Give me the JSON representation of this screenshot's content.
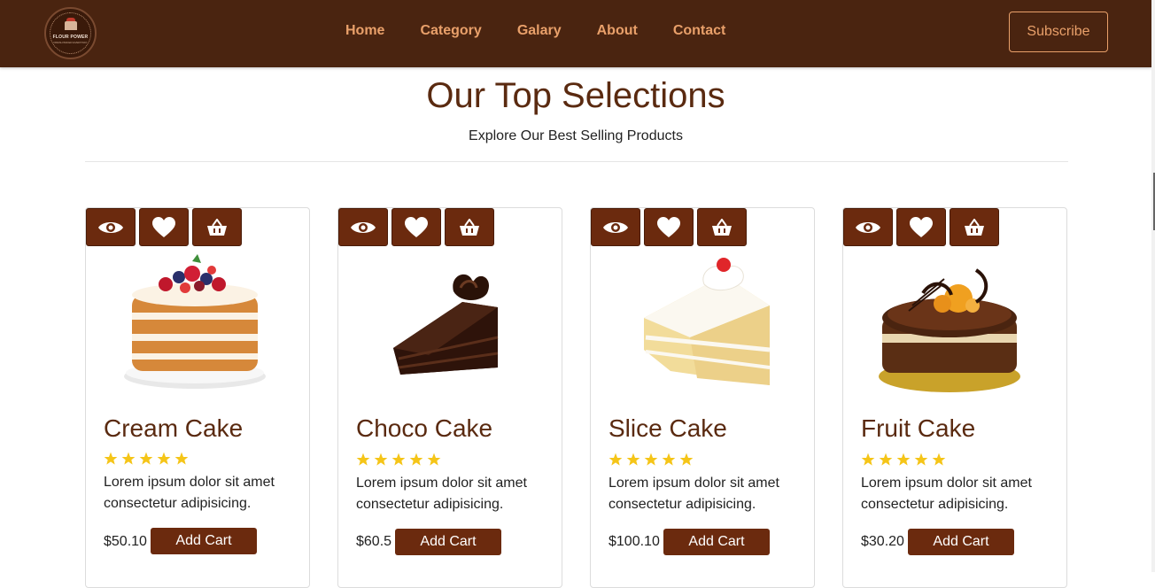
{
  "nav": {
    "logo_text": "FLOUR POWER",
    "logo_sub": "FRESH BAKED EVERYDAY",
    "links": [
      "Home",
      "Category",
      "Galary",
      "About",
      "Contact"
    ],
    "subscribe_label": "Subscribe"
  },
  "section": {
    "title": "Our Top Selections",
    "subtitle": "Explore Our Best Selling Products"
  },
  "products": [
    {
      "name": "Cream Cake",
      "stars": 5,
      "desc": "Lorem ipsum dolor sit amet consectetur adipisicing.",
      "price": "$50.10",
      "button": "Add Cart"
    },
    {
      "name": "Choco Cake",
      "stars": 5,
      "desc": "Lorem ipsum dolor sit amet consectetur adipisicing.",
      "price": "$60.5",
      "button": "Add Cart"
    },
    {
      "name": "Slice Cake",
      "stars": 5,
      "desc": "Lorem ipsum dolor sit amet consectetur adipisicing.",
      "price": "$100.10",
      "button": "Add Cart"
    },
    {
      "name": "Fruit Cake",
      "stars": 5,
      "desc": "Lorem ipsum dolor sit amet consectetur adipisicing.",
      "price": "$30.20",
      "button": "Add Cart"
    }
  ],
  "colors": {
    "navbar": "#4a2410",
    "accent": "#e9a06a",
    "brand": "#6b2a0e",
    "heading": "#5a2a10",
    "star": "#f5c518"
  },
  "card_icons": [
    "eye-icon",
    "heart-icon",
    "basket-icon"
  ]
}
